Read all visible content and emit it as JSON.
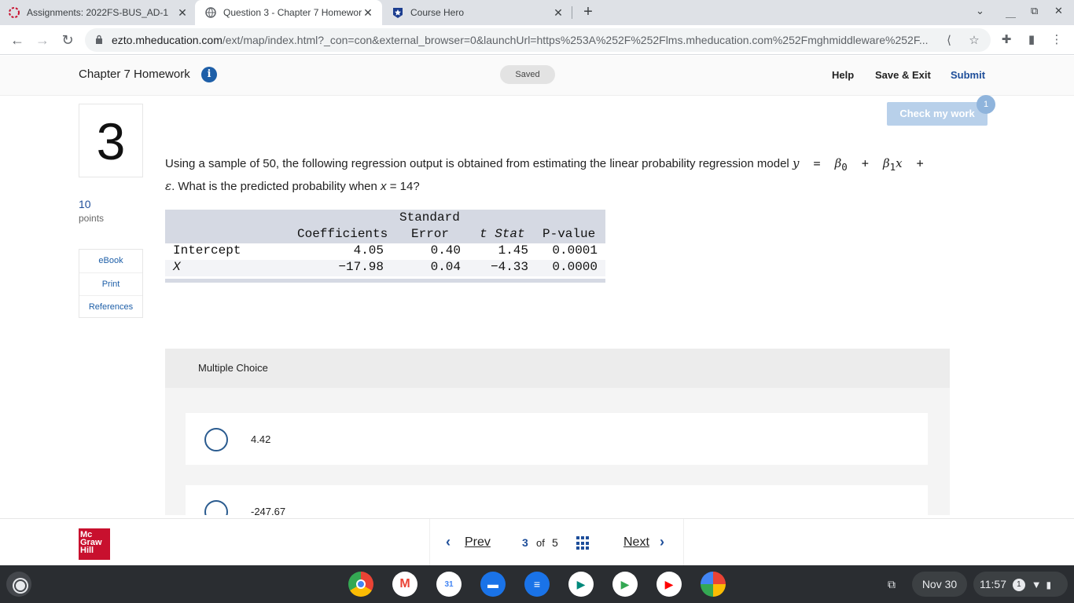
{
  "browser": {
    "tabs": [
      {
        "title": "Assignments: 2022FS-BUS_AD-1"
      },
      {
        "title": "Question 3 - Chapter 7 Homewor"
      },
      {
        "title": "Course Hero"
      }
    ],
    "url_host": "ezto.mheducation.com",
    "url_rest": "/ext/map/index.html?_con=con&external_browser=0&launchUrl=https%253A%252F%252Flms.mheducation.com%252Fmghmiddleware%252F..."
  },
  "header": {
    "title": "Chapter 7 Homework",
    "saved": "Saved",
    "help": "Help",
    "save_exit": "Save & Exit",
    "submit": "Submit"
  },
  "question": {
    "number": "3",
    "points": "10",
    "points_label": "points",
    "tools": [
      "eBook",
      "Print",
      "References"
    ],
    "check_label": "Check my work",
    "check_badge": "1",
    "text_before": "Using a sample of 50, the following regression output is obtained from estimating the linear probability regression model",
    "text_after": ". What is the predicted probability when",
    "x_value": "14?"
  },
  "table": {
    "headers": {
      "coef": "Coefficients",
      "se_top": "Standard",
      "se_bottom": "Error",
      "t": "t Stat",
      "p": "P-value"
    },
    "rows": [
      {
        "label": "Intercept",
        "coef": "4.05",
        "se": "0.40",
        "t": "1.45",
        "p": "0.0001"
      },
      {
        "label": "X",
        "coef": "−17.98",
        "se": "0.04",
        "t": "−4.33",
        "p": "0.0000"
      }
    ]
  },
  "mc": {
    "heading": "Multiple Choice",
    "choices": [
      "4.42",
      "-247.67"
    ]
  },
  "nav": {
    "prev": "Prev",
    "current": "3",
    "of": "of",
    "total": "5",
    "next": "Next"
  },
  "logo": {
    "line1": "Mc",
    "line2": "Graw",
    "line3": "Hill"
  },
  "shelf": {
    "date": "Nov 30",
    "time": "11:57",
    "notif": "1"
  }
}
